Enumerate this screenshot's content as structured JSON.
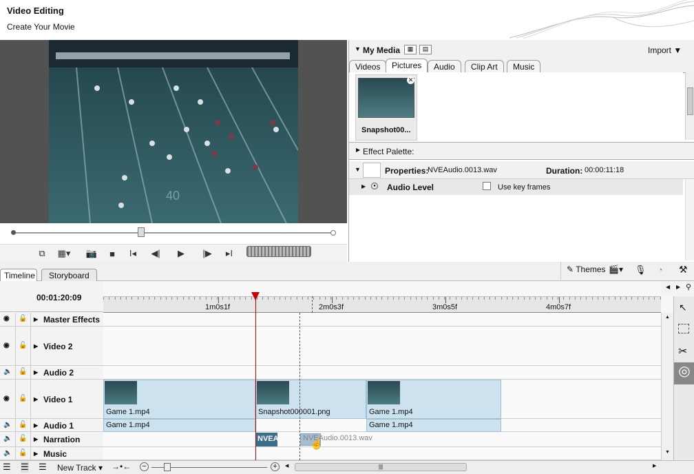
{
  "header": {
    "title": "Video Editing",
    "subtitle": "Create Your Movie"
  },
  "preview": {
    "field_marking": "40",
    "position_fraction": 0.4,
    "controls": [
      {
        "name": "undock-icon",
        "glyph": "⧉"
      },
      {
        "name": "display-mode-icon",
        "glyph": "▦▾"
      },
      {
        "name": "snapshot-icon",
        "glyph": "📷"
      },
      {
        "name": "stop-icon",
        "glyph": "■"
      },
      {
        "name": "mark-in-icon",
        "glyph": "I◂"
      },
      {
        "name": "prev-frame-icon",
        "glyph": "◀|"
      },
      {
        "name": "play-icon",
        "glyph": "▶"
      },
      {
        "name": "next-frame-icon",
        "glyph": "|▶"
      },
      {
        "name": "mark-out-icon",
        "glyph": "▸I"
      }
    ]
  },
  "media": {
    "title": "My Media",
    "import_label": "Import",
    "tabs": [
      "Videos",
      "Pictures",
      "Audio",
      "Clip Art",
      "Music"
    ],
    "active_tab": "Pictures",
    "item_label": "Snapshot00...",
    "effect_palette_label": "Effect Palette:",
    "properties_label": "Properties:",
    "properties_file": "NVEAudio.0013.wav",
    "duration_label": "Duration:",
    "duration_value": "00:00:11:18",
    "audio_level_label": "Audio Level",
    "keyframes_label": "Use key frames"
  },
  "timeline_tabs": {
    "timeline": "Timeline",
    "storyboard": "Storyboard",
    "themes": "Themes"
  },
  "timeline": {
    "timecode": "00:01:20:09",
    "ruler_labels": [
      "1m0s1f",
      "2m0s3f",
      "3m0s5f",
      "4m0s7f"
    ],
    "tracks": {
      "master_effects": "Master Effects",
      "video2": "Video 2",
      "audio2": "Audio 2",
      "video1": "Video 1",
      "audio1": "Audio 1",
      "narration": "Narration",
      "music": "Music"
    },
    "video_clips": [
      "Game 1.mp4",
      "Snapshot000001.png",
      "Game 1.mp4"
    ],
    "audio_clips": [
      "Game 1.mp4",
      "Game 1.mp4"
    ],
    "narration_clip": "NVEA",
    "drag_ghost": "NVEAudio.0013.wav"
  },
  "bottom": {
    "new_track_label": "New Track"
  }
}
